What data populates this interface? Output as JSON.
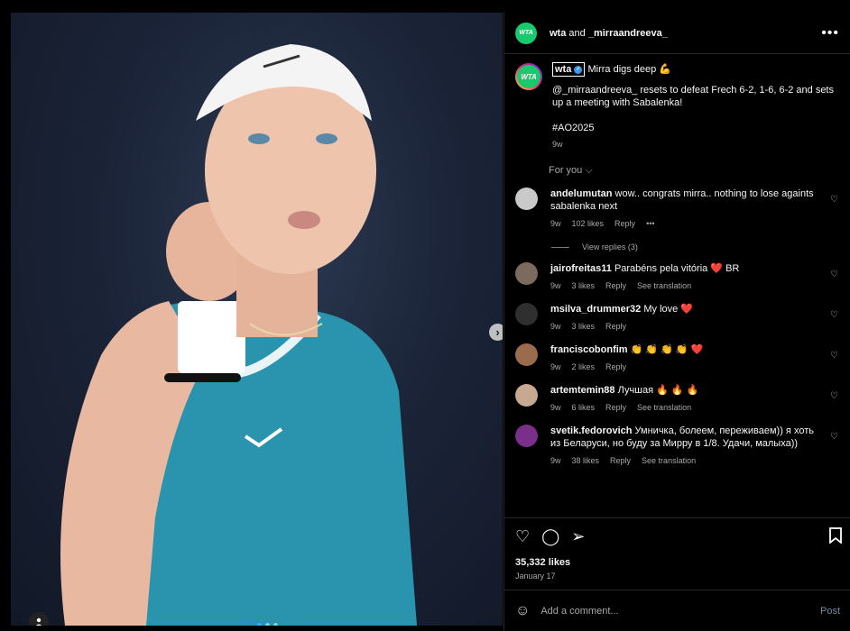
{
  "post": {
    "header_user": "wta",
    "header_and": "and",
    "header_collab": "_mirraandreeva_",
    "more_label": "•••",
    "caption_user": "wta",
    "caption_title": "Mirra digs deep 💪",
    "caption_text": "@_mirraandreeva_ resets to defeat Frech 6-2, 1-6, 6-2 and sets up a meeting with Sabalenka!",
    "caption_tag": "#AO2025",
    "caption_time": "9w",
    "for_you": "For you ⌵",
    "avatar_text": "WTA"
  },
  "comments": [
    {
      "user": "andelumutan",
      "text": "wow.. congrats mirra.. nothing to lose againts sabalenka next",
      "time": "9w",
      "likes": "102 likes",
      "reply": "Reply",
      "extra": "•••",
      "color": "#c9c9c9"
    },
    {
      "user": "jairofreitas11",
      "text": "Parabéns pela vitória ❤️ BR",
      "time": "9w",
      "likes": "3 likes",
      "reply": "Reply",
      "extra": "See translation",
      "color": "#7b6a5d"
    },
    {
      "user": "msilva_drummer32",
      "text": "My love ❤️",
      "time": "9w",
      "likes": "3 likes",
      "reply": "Reply",
      "extra": "",
      "color": "#2f2f2f"
    },
    {
      "user": "franciscobonfim",
      "text": "👏 👏 👏 👏 ❤️",
      "time": "9w",
      "likes": "2 likes",
      "reply": "Reply",
      "extra": "",
      "color": "#9b6b4e"
    },
    {
      "user": "artemtemin88",
      "text": "Лучшая 🔥 🔥 🔥",
      "time": "9w",
      "likes": "6 likes",
      "reply": "Reply",
      "extra": "See translation",
      "color": "#c7a891"
    },
    {
      "user": "svetik.fedorovich",
      "text": "Умничка, болеем, переживаем)) я хоть из Беларуси, но буду за Мирру в 1/8. Удачи, малыха))",
      "time": "9w",
      "likes": "38 likes",
      "reply": "Reply",
      "extra": "See translation",
      "color": "#7a2f8a"
    }
  ],
  "view_replies": "View replies (3)",
  "actions": {
    "likes": "35,332 likes",
    "date": "January 17"
  },
  "add_comment": {
    "placeholder": "Add a comment...",
    "post_label": "Post"
  },
  "next_label": "›"
}
